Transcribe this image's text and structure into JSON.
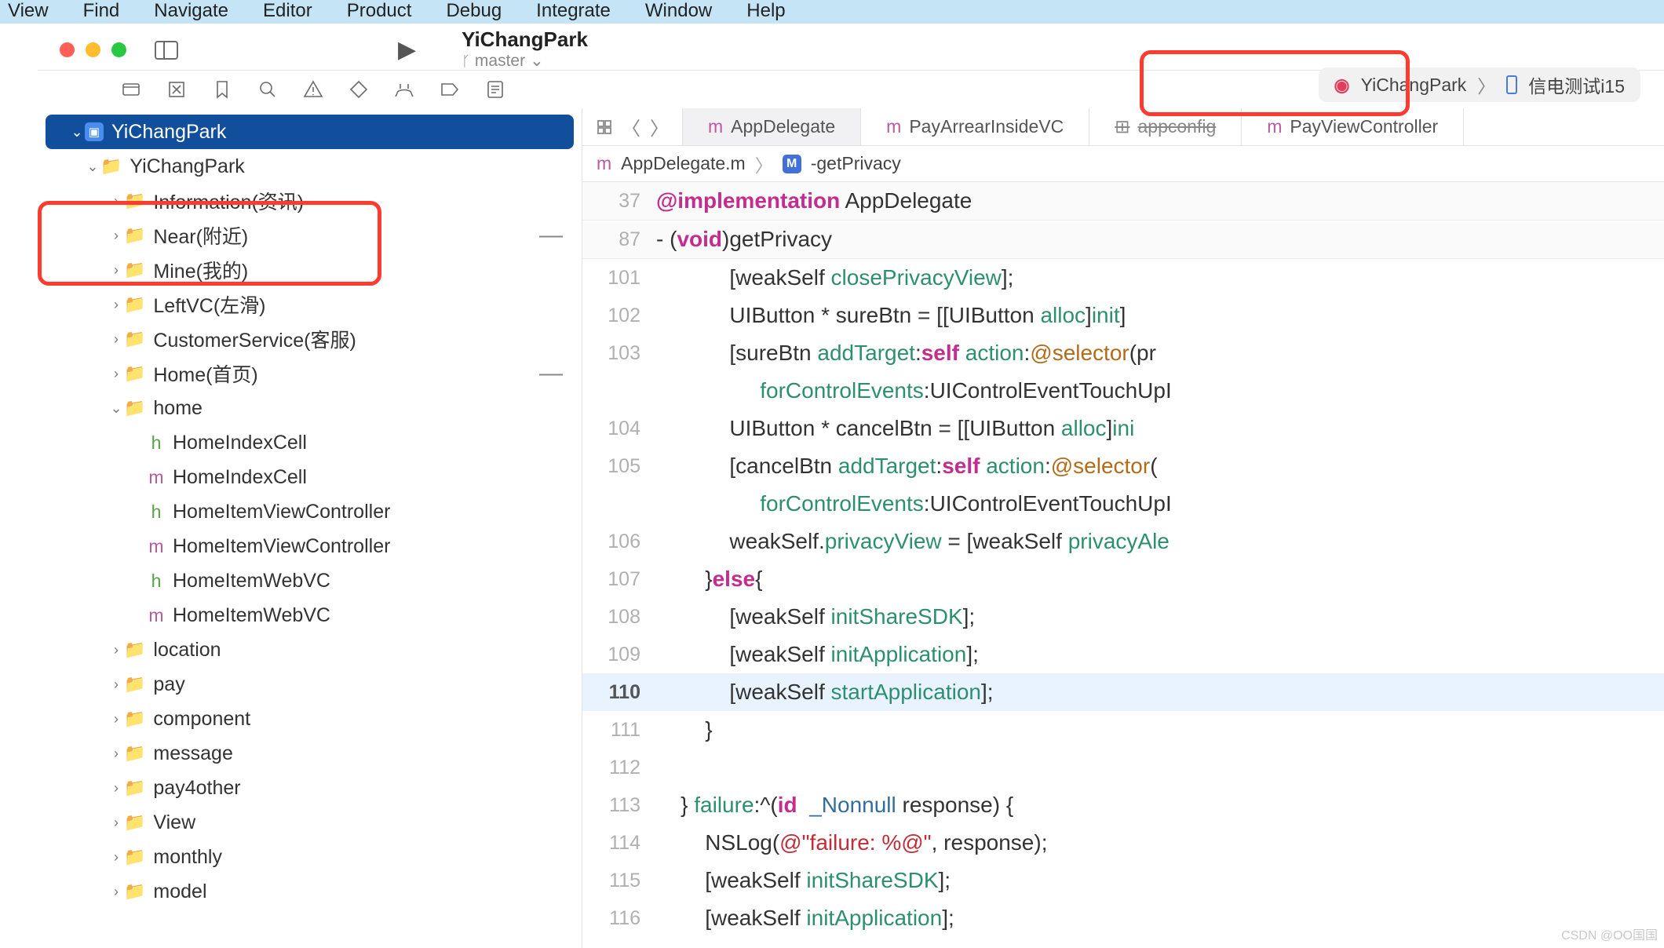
{
  "menubar": [
    "View",
    "Find",
    "Navigate",
    "Editor",
    "Product",
    "Debug",
    "Integrate",
    "Window",
    "Help"
  ],
  "scheme": {
    "name": "YiChangPark",
    "branch": "master"
  },
  "target": {
    "project": "YiChangPark",
    "device": "信电测试i15"
  },
  "tabs": [
    {
      "icon": "m",
      "label": "AppDelegate",
      "active": true
    },
    {
      "icon": "m",
      "label": "PayArrearInsideVC"
    },
    {
      "icon": "cfg",
      "label": "appconfig",
      "strike": true
    },
    {
      "icon": "m",
      "label": "PayViewController"
    }
  ],
  "jumpbar": {
    "file": "AppDelegate.m",
    "method": "-getPrivacy"
  },
  "tree": [
    {
      "d": 0,
      "chev": "v",
      "ic": "app",
      "label": "YiChangPark",
      "sel": true
    },
    {
      "d": 1,
      "chev": "v",
      "ic": "folder",
      "label": "YiChangPark"
    },
    {
      "d": 2,
      "chev": ">",
      "ic": "folder",
      "label": "Information(资讯)"
    },
    {
      "d": 2,
      "chev": ">",
      "ic": "folder",
      "label": "Near(附近)",
      "dash": true
    },
    {
      "d": 2,
      "chev": ">",
      "ic": "folder",
      "label": "Mine(我的)"
    },
    {
      "d": 2,
      "chev": ">",
      "ic": "folder",
      "label": "LeftVC(左滑)"
    },
    {
      "d": 2,
      "chev": ">",
      "ic": "folder",
      "label": "CustomerService(客服)"
    },
    {
      "d": 2,
      "chev": ">",
      "ic": "folder",
      "label": "Home(首页)",
      "dash": true
    },
    {
      "d": 2,
      "chev": "v",
      "ic": "folder",
      "label": "home"
    },
    {
      "d": 3,
      "ic": "h",
      "label": "HomeIndexCell"
    },
    {
      "d": 3,
      "ic": "m",
      "label": "HomeIndexCell"
    },
    {
      "d": 3,
      "ic": "h",
      "label": "HomeItemViewController"
    },
    {
      "d": 3,
      "ic": "m",
      "label": "HomeItemViewController"
    },
    {
      "d": 3,
      "ic": "h",
      "label": "HomeItemWebVC"
    },
    {
      "d": 3,
      "ic": "m",
      "label": "HomeItemWebVC"
    },
    {
      "d": 2,
      "chev": ">",
      "ic": "folder",
      "label": "location"
    },
    {
      "d": 2,
      "chev": ">",
      "ic": "folder",
      "label": "pay"
    },
    {
      "d": 2,
      "chev": ">",
      "ic": "folder",
      "label": "component"
    },
    {
      "d": 2,
      "chev": ">",
      "ic": "folder",
      "label": "message"
    },
    {
      "d": 2,
      "chev": ">",
      "ic": "folder",
      "label": "pay4other"
    },
    {
      "d": 2,
      "chev": ">",
      "ic": "folder",
      "label": "View"
    },
    {
      "d": 2,
      "chev": ">",
      "ic": "folder",
      "label": "monthly"
    },
    {
      "d": 2,
      "chev": ">",
      "ic": "folder",
      "label": "model"
    }
  ],
  "code": [
    {
      "n": 37,
      "sticky": true,
      "html": "<span class='kw'>@implementation</span> AppDelegate"
    },
    {
      "n": 87,
      "sticky": true,
      "html": "- (<span class='kw'>void</span>)getPrivacy"
    },
    {
      "n": "",
      "html": ""
    },
    {
      "n": 101,
      "html": "            [weakSelf <span class='mth'>closePrivacyView</span>];"
    },
    {
      "n": 102,
      "html": "            UIButton * sureBtn = [[UIButton <span class='mth'>alloc</span>]<span class='mth'>init</span>]"
    },
    {
      "n": 103,
      "html": "            [sureBtn <span class='mth'>addTarget</span>:<span class='kw'>self</span> <span class='mth'>action</span>:<span class='atsel'>@selector</span>(pr"
    },
    {
      "n": "",
      "html": "                 <span class='mth'>forControlEvents</span>:UIControlEventTouchUpI"
    },
    {
      "n": 104,
      "html": "            UIButton * cancelBtn = [[UIButton <span class='mth'>alloc</span>]<span class='mth'>ini</span>"
    },
    {
      "n": 105,
      "html": "            [cancelBtn <span class='mth'>addTarget</span>:<span class='kw'>self</span> <span class='mth'>action</span>:<span class='atsel'>@selector</span>("
    },
    {
      "n": "",
      "html": "                 <span class='mth'>forControlEvents</span>:UIControlEventTouchUpI"
    },
    {
      "n": 106,
      "html": "            weakSelf.<span class='mth'>privacyView</span> = [weakSelf <span class='mth'>privacyAle</span>"
    },
    {
      "n": 107,
      "html": "        }<span class='kw'>else</span>{"
    },
    {
      "n": 108,
      "html": "            [weakSelf <span class='mth'>initShareSDK</span>];"
    },
    {
      "n": 109,
      "html": "            [weakSelf <span class='mth'>initApplication</span>];"
    },
    {
      "n": 110,
      "hl": true,
      "html": "            [weakSelf <span class='mth'>startApplication</span>];"
    },
    {
      "n": 111,
      "html": "        }"
    },
    {
      "n": 112,
      "html": ""
    },
    {
      "n": 113,
      "html": "    } <span class='mth'>failure</span>:^(<span class='kw'>id</span>  <span class='type'>_Nonnull</span> response) {"
    },
    {
      "n": 114,
      "html": "        NSLog(<span class='str'>@\"failure: %@\"</span>, response);"
    },
    {
      "n": 115,
      "html": "        [weakSelf <span class='mth'>initShareSDK</span>];"
    },
    {
      "n": 116,
      "html": "        [weakSelf <span class='mth'>initApplication</span>];"
    }
  ],
  "watermark": "CSDN @OO国国"
}
